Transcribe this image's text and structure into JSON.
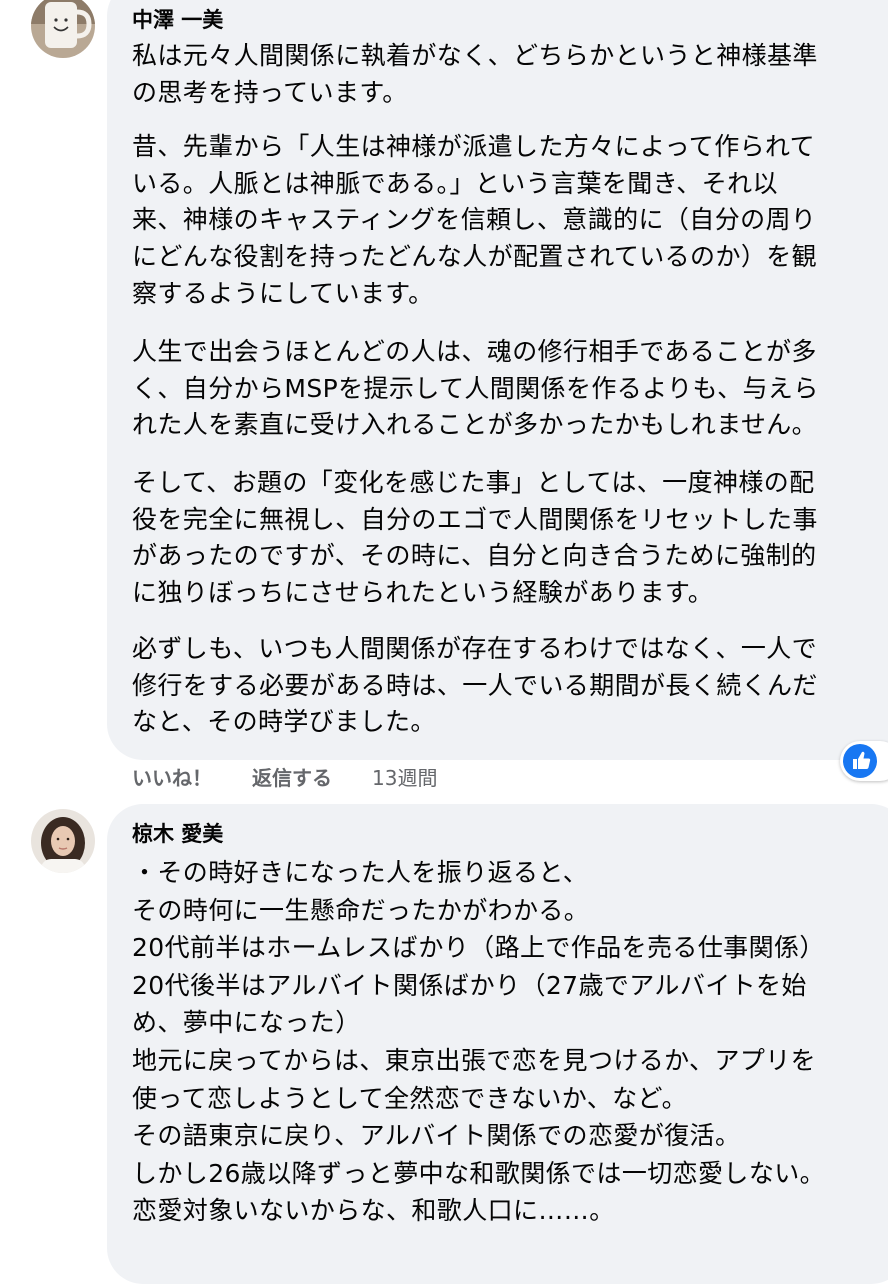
{
  "comments": [
    {
      "author": "中澤 一美",
      "paragraphs": [
        [
          "私は元々人間関係に執着がなく、どちらかというと神様基準",
          "の思考を持っています。"
        ],
        [
          "昔、先輩から「人生は神様が派遣した方々によって作られて",
          "いる。人脈とは神脈である。」という言葉を聞き、それ以",
          "来、神様のキャスティングを信頼し、意識的に（自分の周り",
          "にどんな役割を持ったどんな人が配置されているのか）を観",
          "察するようにしています。"
        ],
        [
          "人生で出会うほとんどの人は、魂の修行相手であることが多",
          "く、自分からMSPを提示して人間関係を作るよりも、与えら",
          "れた人を素直に受け入れることが多かったかもしれません。"
        ],
        [
          "そして、お題の「変化を感じた事」としては、一度神様の配",
          "役を完全に無視し、自分のエゴで人間関係をリセットした事",
          "があったのですが、その時に、自分と向き合うために強制的",
          "に独りぼっちにさせられたという経験があります。"
        ],
        [
          "必ずしも、いつも人間関係が存在するわけではなく、一人で",
          "修行をする必要がある時は、一人でいる期間が長く続くんだ",
          "なと、その時学びました。"
        ]
      ],
      "actions": {
        "like": "いいね！",
        "reply": "返信する",
        "time": "13週間"
      }
    },
    {
      "author": "椋木 愛美",
      "lines": [
        "・その時好きになった人を振り返ると、",
        "その時何に一生懸命だったかがわかる。",
        "20代前半はホームレスばかり（路上で作品を売る仕事関係）",
        "20代後半はアルバイト関係ばかり（27歳でアルバイトを始",
        "め、夢中になった）",
        "地元に戻ってからは、東京出張で恋を見つけるか、アプリを",
        "使って恋しようとして全然恋できないか、など。",
        "その語東京に戻り、アルバイト関係での恋愛が復活。",
        "しかし26歳以降ずっと夢中な和歌関係では一切恋愛しない。",
        "恋愛対象いないからな、和歌人口に……。"
      ]
    }
  ],
  "colors": {
    "bubble": "#f0f2f5",
    "meta_text": "#65676b",
    "like_blue": "#1877f2"
  }
}
